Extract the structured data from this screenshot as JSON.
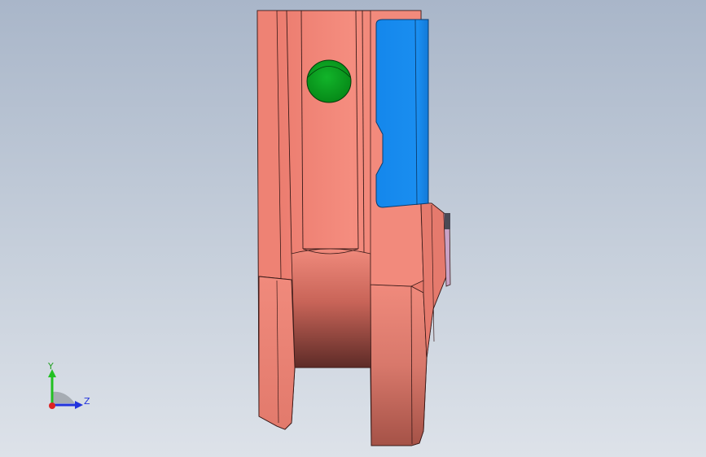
{
  "viewport": {
    "background_top": "#a9b6c9",
    "background_bottom": "#dde2e9"
  },
  "model": {
    "body_color": "#f08a7c",
    "body_dark": "#7a3a35",
    "clamp_color": "#1a8ef0",
    "pin_color": "#0aa01e",
    "edge_color": "#3a1a18"
  },
  "triad": {
    "y_label": "Y",
    "z_label": "Z",
    "y_color": "#22c022",
    "z_color": "#2233dd",
    "x_color": "#dd2222"
  }
}
